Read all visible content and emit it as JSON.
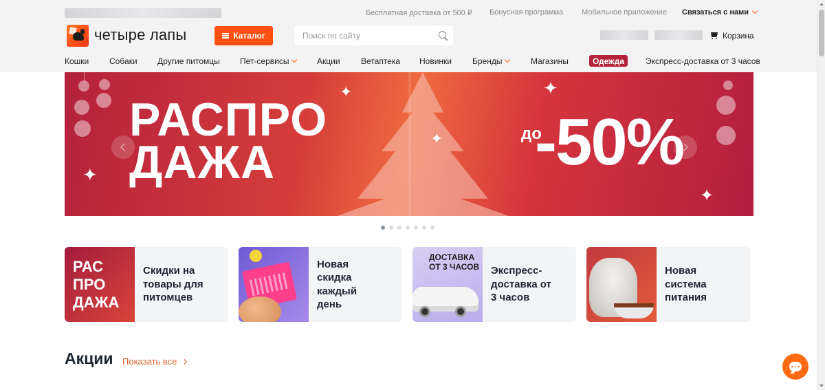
{
  "topbar": {
    "links": [
      "Бесплатная доставка от 500 ₽",
      "Бонусная программа",
      "Мобильное приложение"
    ],
    "contact_label": "Связаться с нами"
  },
  "header": {
    "brand": "четыре лапы",
    "catalog_label": "Каталог",
    "search_placeholder": "Поиск по сайту",
    "cart_label": "Корзина"
  },
  "nav": {
    "items": [
      "Кошки",
      "Собаки",
      "Другие питомцы",
      "Пет-сервисы",
      "Акции",
      "Ветаптека",
      "Новинки",
      "Бренды",
      "Магазины",
      "Одежда",
      "Экспресс-доставка от 3 часов"
    ]
  },
  "banner": {
    "title_line1": "РАСПРО",
    "title_line2": "ДАЖА",
    "prefix": "до",
    "discount": "-50%",
    "slides_count": 7,
    "active_slide": 1
  },
  "promos": [
    {
      "thumb_text": "РАС\nПРО\nДАЖА",
      "text": "Скидки на\nтовары для\nпитомцев"
    },
    {
      "thumb_text": "",
      "text": "Новая\nскидка\nкаждый\nдень"
    },
    {
      "thumb_text": "ДОСТАВКА\nОТ 3 ЧАСОВ",
      "text": "Экспресс-\nдоставка от\n3 часов"
    },
    {
      "thumb_text": "",
      "text": "Новая\nсистема\nпитания"
    }
  ],
  "section": {
    "title": "Акции",
    "show_all_label": "Показать все"
  },
  "colors": {
    "accent": "#ff5014",
    "clothes_pill": "#b3243a",
    "heading": "#1f2633"
  }
}
